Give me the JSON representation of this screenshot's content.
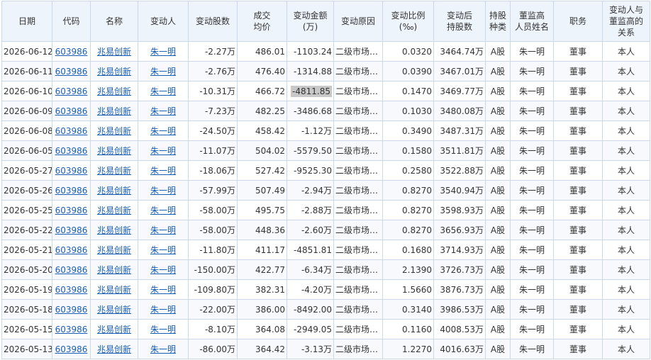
{
  "headers": {
    "date": "日期",
    "code": "代码",
    "name": "名称",
    "person": "变动人",
    "shares": "变动股数",
    "price": "成交\n均价",
    "amount": "变动金额\n(万)",
    "reason": "变动原因",
    "ratio": "变动比例\n(‰)",
    "after": "变动后\n持股数",
    "kind": "持股\n种类",
    "exec": "董监高\n人员姓名",
    "duty": "职务",
    "relation": "变动人与\n董监高的\n关系"
  },
  "highlighted_cell": {
    "row": 2,
    "column": "amount"
  },
  "rows": [
    {
      "date": "2026-06-12",
      "code": "603986",
      "name": "兆易创新",
      "person": "朱一明",
      "shares": "-2.27万",
      "price": "486.01",
      "amount": "-1103.24",
      "reason": "二级市场买卖",
      "ratio": "0.0320",
      "after": "3464.74万",
      "kind": "A股",
      "exec": "朱一明",
      "duty": "董事",
      "relation": "本人"
    },
    {
      "date": "2026-06-11",
      "code": "603986",
      "name": "兆易创新",
      "person": "朱一明",
      "shares": "-2.76万",
      "price": "476.40",
      "amount": "-1314.88",
      "reason": "二级市场买卖",
      "ratio": "0.0390",
      "after": "3467.01万",
      "kind": "A股",
      "exec": "朱一明",
      "duty": "董事",
      "relation": "本人"
    },
    {
      "date": "2026-06-10",
      "code": "603986",
      "name": "兆易创新",
      "person": "朱一明",
      "shares": "-10.31万",
      "price": "466.72",
      "amount": "-4811.85",
      "reason": "二级市场买卖",
      "ratio": "0.1470",
      "after": "3469.77万",
      "kind": "A股",
      "exec": "朱一明",
      "duty": "董事",
      "relation": "本人"
    },
    {
      "date": "2026-06-09",
      "code": "603986",
      "name": "兆易创新",
      "person": "朱一明",
      "shares": "-7.23万",
      "price": "482.25",
      "amount": "-3486.68",
      "reason": "二级市场买卖",
      "ratio": "0.1030",
      "after": "3480.08万",
      "kind": "A股",
      "exec": "朱一明",
      "duty": "董事",
      "relation": "本人"
    },
    {
      "date": "2026-06-08",
      "code": "603986",
      "name": "兆易创新",
      "person": "朱一明",
      "shares": "-24.50万",
      "price": "458.42",
      "amount": "-1.12万",
      "reason": "二级市场买卖",
      "ratio": "0.3490",
      "after": "3487.31万",
      "kind": "A股",
      "exec": "朱一明",
      "duty": "董事",
      "relation": "本人"
    },
    {
      "date": "2026-06-05",
      "code": "603986",
      "name": "兆易创新",
      "person": "朱一明",
      "shares": "-11.07万",
      "price": "504.02",
      "amount": "-5579.50",
      "reason": "二级市场买卖",
      "ratio": "0.1580",
      "after": "3511.81万",
      "kind": "A股",
      "exec": "朱一明",
      "duty": "董事",
      "relation": "本人"
    },
    {
      "date": "2026-05-27",
      "code": "603986",
      "name": "兆易创新",
      "person": "朱一明",
      "shares": "-18.06万",
      "price": "527.42",
      "amount": "-9525.30",
      "reason": "二级市场买卖",
      "ratio": "0.2580",
      "after": "3522.88万",
      "kind": "A股",
      "exec": "朱一明",
      "duty": "董事",
      "relation": "本人"
    },
    {
      "date": "2026-05-26",
      "code": "603986",
      "name": "兆易创新",
      "person": "朱一明",
      "shares": "-57.99万",
      "price": "507.49",
      "amount": "-2.94万",
      "reason": "二级市场买卖",
      "ratio": "0.8270",
      "after": "3540.94万",
      "kind": "A股",
      "exec": "朱一明",
      "duty": "董事",
      "relation": "本人"
    },
    {
      "date": "2026-05-25",
      "code": "603986",
      "name": "兆易创新",
      "person": "朱一明",
      "shares": "-58.00万",
      "price": "495.75",
      "amount": "-2.88万",
      "reason": "二级市场买卖",
      "ratio": "0.8270",
      "after": "3598.93万",
      "kind": "A股",
      "exec": "朱一明",
      "duty": "董事",
      "relation": "本人"
    },
    {
      "date": "2026-05-22",
      "code": "603986",
      "name": "兆易创新",
      "person": "朱一明",
      "shares": "-58.00万",
      "price": "448.36",
      "amount": "-2.60万",
      "reason": "二级市场买卖",
      "ratio": "0.8270",
      "after": "3656.93万",
      "kind": "A股",
      "exec": "朱一明",
      "duty": "董事",
      "relation": "本人"
    },
    {
      "date": "2026-05-21",
      "code": "603986",
      "name": "兆易创新",
      "person": "朱一明",
      "shares": "-11.80万",
      "price": "411.17",
      "amount": "-4851.81",
      "reason": "二级市场买卖",
      "ratio": "0.1680",
      "after": "3714.93万",
      "kind": "A股",
      "exec": "朱一明",
      "duty": "董事",
      "relation": "本人"
    },
    {
      "date": "2026-05-20",
      "code": "603986",
      "name": "兆易创新",
      "person": "朱一明",
      "shares": "-150.00万",
      "price": "422.77",
      "amount": "-6.34万",
      "reason": "二级市场买卖",
      "ratio": "2.1390",
      "after": "3726.73万",
      "kind": "A股",
      "exec": "朱一明",
      "duty": "董事",
      "relation": "本人"
    },
    {
      "date": "2026-05-19",
      "code": "603986",
      "name": "兆易创新",
      "person": "朱一明",
      "shares": "-109.80万",
      "price": "382.31",
      "amount": "-4.20万",
      "reason": "二级市场买卖",
      "ratio": "1.5660",
      "after": "3876.73万",
      "kind": "A股",
      "exec": "朱一明",
      "duty": "董事",
      "relation": "本人"
    },
    {
      "date": "2026-05-18",
      "code": "603986",
      "name": "兆易创新",
      "person": "朱一明",
      "shares": "-22.00万",
      "price": "386.00",
      "amount": "-8492.00",
      "reason": "二级市场买卖",
      "ratio": "0.3140",
      "after": "3986.53万",
      "kind": "A股",
      "exec": "朱一明",
      "duty": "董事",
      "relation": "本人"
    },
    {
      "date": "2026-05-15",
      "code": "603986",
      "name": "兆易创新",
      "person": "朱一明",
      "shares": "-8.10万",
      "price": "364.08",
      "amount": "-2949.05",
      "reason": "二级市场买卖",
      "ratio": "0.1160",
      "after": "4008.53万",
      "kind": "A股",
      "exec": "朱一明",
      "duty": "董事",
      "relation": "本人"
    },
    {
      "date": "2026-05-13",
      "code": "603986",
      "name": "兆易创新",
      "person": "朱一明",
      "shares": "-86.00万",
      "price": "364.42",
      "amount": "-3.13万",
      "reason": "二级市场买卖",
      "ratio": "1.2270",
      "after": "4016.63万",
      "kind": "A股",
      "exec": "朱一明",
      "duty": "董事",
      "relation": "本人"
    }
  ]
}
